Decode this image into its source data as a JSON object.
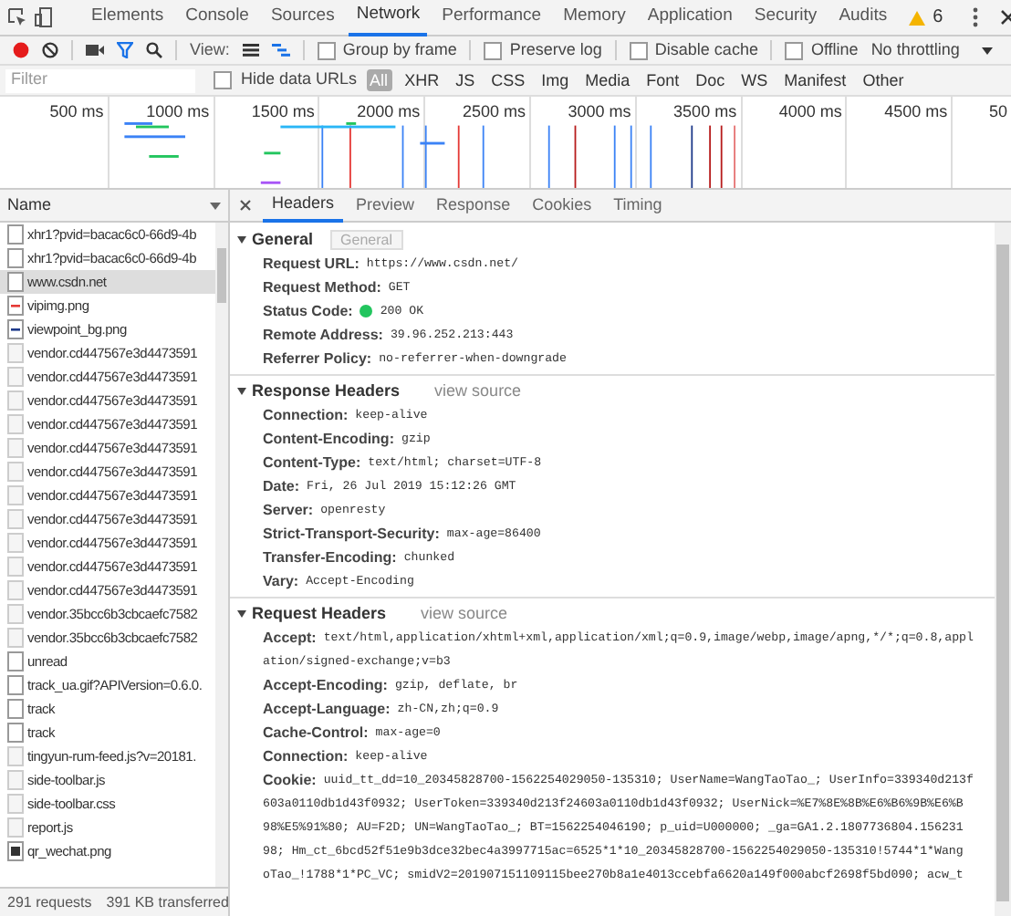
{
  "main_tabs": [
    {
      "label": "Elements",
      "selected": false
    },
    {
      "label": "Console",
      "selected": false
    },
    {
      "label": "Sources",
      "selected": false
    },
    {
      "label": "Network",
      "selected": true
    },
    {
      "label": "Performance",
      "selected": false
    },
    {
      "label": "Memory",
      "selected": false
    },
    {
      "label": "Application",
      "selected": false
    },
    {
      "label": "Security",
      "selected": false
    },
    {
      "label": "Audits",
      "selected": false
    }
  ],
  "warnings": "6",
  "toolbar": {
    "view_label": "View:",
    "options": [
      {
        "label": "Group by frame",
        "checked": false
      },
      {
        "label": "Preserve log",
        "checked": false
      },
      {
        "label": "Disable cache",
        "checked": false
      },
      {
        "label": "Offline",
        "checked": false
      }
    ],
    "throttling": "No throttling"
  },
  "filter": {
    "placeholder": "Filter",
    "hide_data_urls": {
      "label": "Hide data URLs",
      "checked": false
    },
    "types": [
      {
        "label": "All",
        "selected": true
      },
      {
        "label": "XHR",
        "selected": false
      },
      {
        "label": "JS",
        "selected": false
      },
      {
        "label": "CSS",
        "selected": false
      },
      {
        "label": "Img",
        "selected": false
      },
      {
        "label": "Media",
        "selected": false
      },
      {
        "label": "Font",
        "selected": false
      },
      {
        "label": "Doc",
        "selected": false
      },
      {
        "label": "WS",
        "selected": false
      },
      {
        "label": "Manifest",
        "selected": false
      },
      {
        "label": "Other",
        "selected": false
      }
    ]
  },
  "timeline": {
    "ticks": [
      "500 ms",
      "1000 ms",
      "1500 ms",
      "2000 ms",
      "2500 ms",
      "3000 ms",
      "3500 ms",
      "4000 ms",
      "4500 ms",
      "50"
    ]
  },
  "requests": {
    "column": "Name",
    "rows": [
      {
        "name": "xhr1?pvid=bacac6c0-66d9-4b",
        "kind": "doc",
        "selected": false
      },
      {
        "name": "xhr1?pvid=bacac6c0-66d9-4b",
        "kind": "doc",
        "selected": false
      },
      {
        "name": "www.csdn.net",
        "kind": "doc",
        "selected": true
      },
      {
        "name": "vipimg.png",
        "kind": "image-red",
        "selected": false
      },
      {
        "name": "viewpoint_bg.png",
        "kind": "image-blue",
        "selected": false
      },
      {
        "name": "vendor.cd447567e3d4473591",
        "kind": "script",
        "selected": false
      },
      {
        "name": "vendor.cd447567e3d4473591",
        "kind": "script",
        "selected": false
      },
      {
        "name": "vendor.cd447567e3d4473591",
        "kind": "script",
        "selected": false
      },
      {
        "name": "vendor.cd447567e3d4473591",
        "kind": "script",
        "selected": false
      },
      {
        "name": "vendor.cd447567e3d4473591",
        "kind": "script",
        "selected": false
      },
      {
        "name": "vendor.cd447567e3d4473591",
        "kind": "script",
        "selected": false
      },
      {
        "name": "vendor.cd447567e3d4473591",
        "kind": "script",
        "selected": false
      },
      {
        "name": "vendor.cd447567e3d4473591",
        "kind": "script",
        "selected": false
      },
      {
        "name": "vendor.cd447567e3d4473591",
        "kind": "script",
        "selected": false
      },
      {
        "name": "vendor.cd447567e3d4473591",
        "kind": "script",
        "selected": false
      },
      {
        "name": "vendor.cd447567e3d4473591",
        "kind": "script",
        "selected": false
      },
      {
        "name": "vendor.35bcc6b3cbcaefc7582",
        "kind": "script",
        "selected": false
      },
      {
        "name": "vendor.35bcc6b3cbcaefc7582",
        "kind": "script",
        "selected": false
      },
      {
        "name": "unread",
        "kind": "doc",
        "selected": false
      },
      {
        "name": "track_ua.gif?APIVersion=0.6.0.",
        "kind": "doc",
        "selected": false
      },
      {
        "name": "track",
        "kind": "doc",
        "selected": false
      },
      {
        "name": "track",
        "kind": "doc",
        "selected": false
      },
      {
        "name": "tingyun-rum-feed.js?v=20181.",
        "kind": "script",
        "selected": false
      },
      {
        "name": "side-toolbar.js",
        "kind": "script",
        "selected": false
      },
      {
        "name": "side-toolbar.css",
        "kind": "script",
        "selected": false
      },
      {
        "name": "report.js",
        "kind": "script",
        "selected": false
      },
      {
        "name": "qr_wechat.png",
        "kind": "image-dark",
        "selected": false
      }
    ],
    "status": [
      "291 requests",
      "391 KB transferred"
    ]
  },
  "details": {
    "tabs": [
      {
        "label": "Headers",
        "selected": true
      },
      {
        "label": "Preview",
        "selected": false
      },
      {
        "label": "Response",
        "selected": false
      },
      {
        "label": "Cookies",
        "selected": false
      },
      {
        "label": "Timing",
        "selected": false
      }
    ],
    "tooltip": "General",
    "sections": [
      {
        "title": "General",
        "expanded": true,
        "fields": [
          {
            "key": "Request URL:",
            "value": [
              "https://www.csdn.net/"
            ]
          },
          {
            "key": "Request Method:",
            "value": [
              "GET"
            ]
          },
          {
            "key": "Status Code:",
            "value": [
              "200 OK"
            ],
            "color": "#22c55e"
          },
          {
            "key": "Remote Address:",
            "value": [
              "39.96.252.213:443"
            ]
          },
          {
            "key": "Referrer Policy:",
            "value": [
              "no-referrer-when-downgrade"
            ]
          }
        ]
      },
      {
        "title": "Response Headers",
        "expanded": true,
        "link": "view source",
        "fields": [
          {
            "key": "Connection:",
            "value": [
              "keep-alive"
            ]
          },
          {
            "key": "Content-Encoding:",
            "value": [
              "gzip"
            ]
          },
          {
            "key": "Content-Type:",
            "value": [
              "text/html; charset=UTF-8"
            ]
          },
          {
            "key": "Date:",
            "value": [
              "Fri, 26 Jul 2019 15:12:26 GMT"
            ]
          },
          {
            "key": "Server:",
            "value": [
              "openresty"
            ]
          },
          {
            "key": "Strict-Transport-Security:",
            "value": [
              "max-age=86400"
            ]
          },
          {
            "key": "Transfer-Encoding:",
            "value": [
              "chunked"
            ]
          },
          {
            "key": "Vary:",
            "value": [
              "Accept-Encoding"
            ]
          }
        ]
      },
      {
        "title": "Request Headers",
        "expanded": true,
        "link": "view source",
        "fields": [
          {
            "key": "Accept:",
            "value": [
              "text/html,application/xhtml+xml,application/xml;q=0.9,image/webp,image/apng,*/*;q=0.8,appl",
              "ation/signed-exchange;v=b3"
            ]
          },
          {
            "key": "Accept-Encoding:",
            "value": [
              "gzip, deflate, br"
            ]
          },
          {
            "key": "Accept-Language:",
            "value": [
              "zh-CN,zh;q=0.9"
            ]
          },
          {
            "key": "Cache-Control:",
            "value": [
              "max-age=0"
            ]
          },
          {
            "key": "Connection:",
            "value": [
              "keep-alive"
            ]
          },
          {
            "key": "Cookie:",
            "value": [
              "uuid_tt_dd=10_20345828700-1562254029050-135310; UserName=WangTaoTao_; UserInfo=339340d213f",
              "603a0110db1d43f0932; UserToken=339340d213f24603a0110db1d43f0932; UserNick=%E7%8E%8B%E6%B6%9B%E6%B",
              "98%E5%91%80; AU=F2D; UN=WangTaoTao_; BT=1562254046190; p_uid=U000000; _ga=GA1.2.1807736804.156231",
              "98; Hm_ct_6bcd52f51e9b3dce32bec4a3997715ac=6525*1*10_20345828700-1562254029050-135310!5744*1*Wang",
              "oTao_!1788*1*PC_VC; smidV2=201907151109115bee270b8a1e4013ccebfa6620a149f000abcf2698f5bd090; acw_t"
            ]
          }
        ]
      }
    ]
  }
}
